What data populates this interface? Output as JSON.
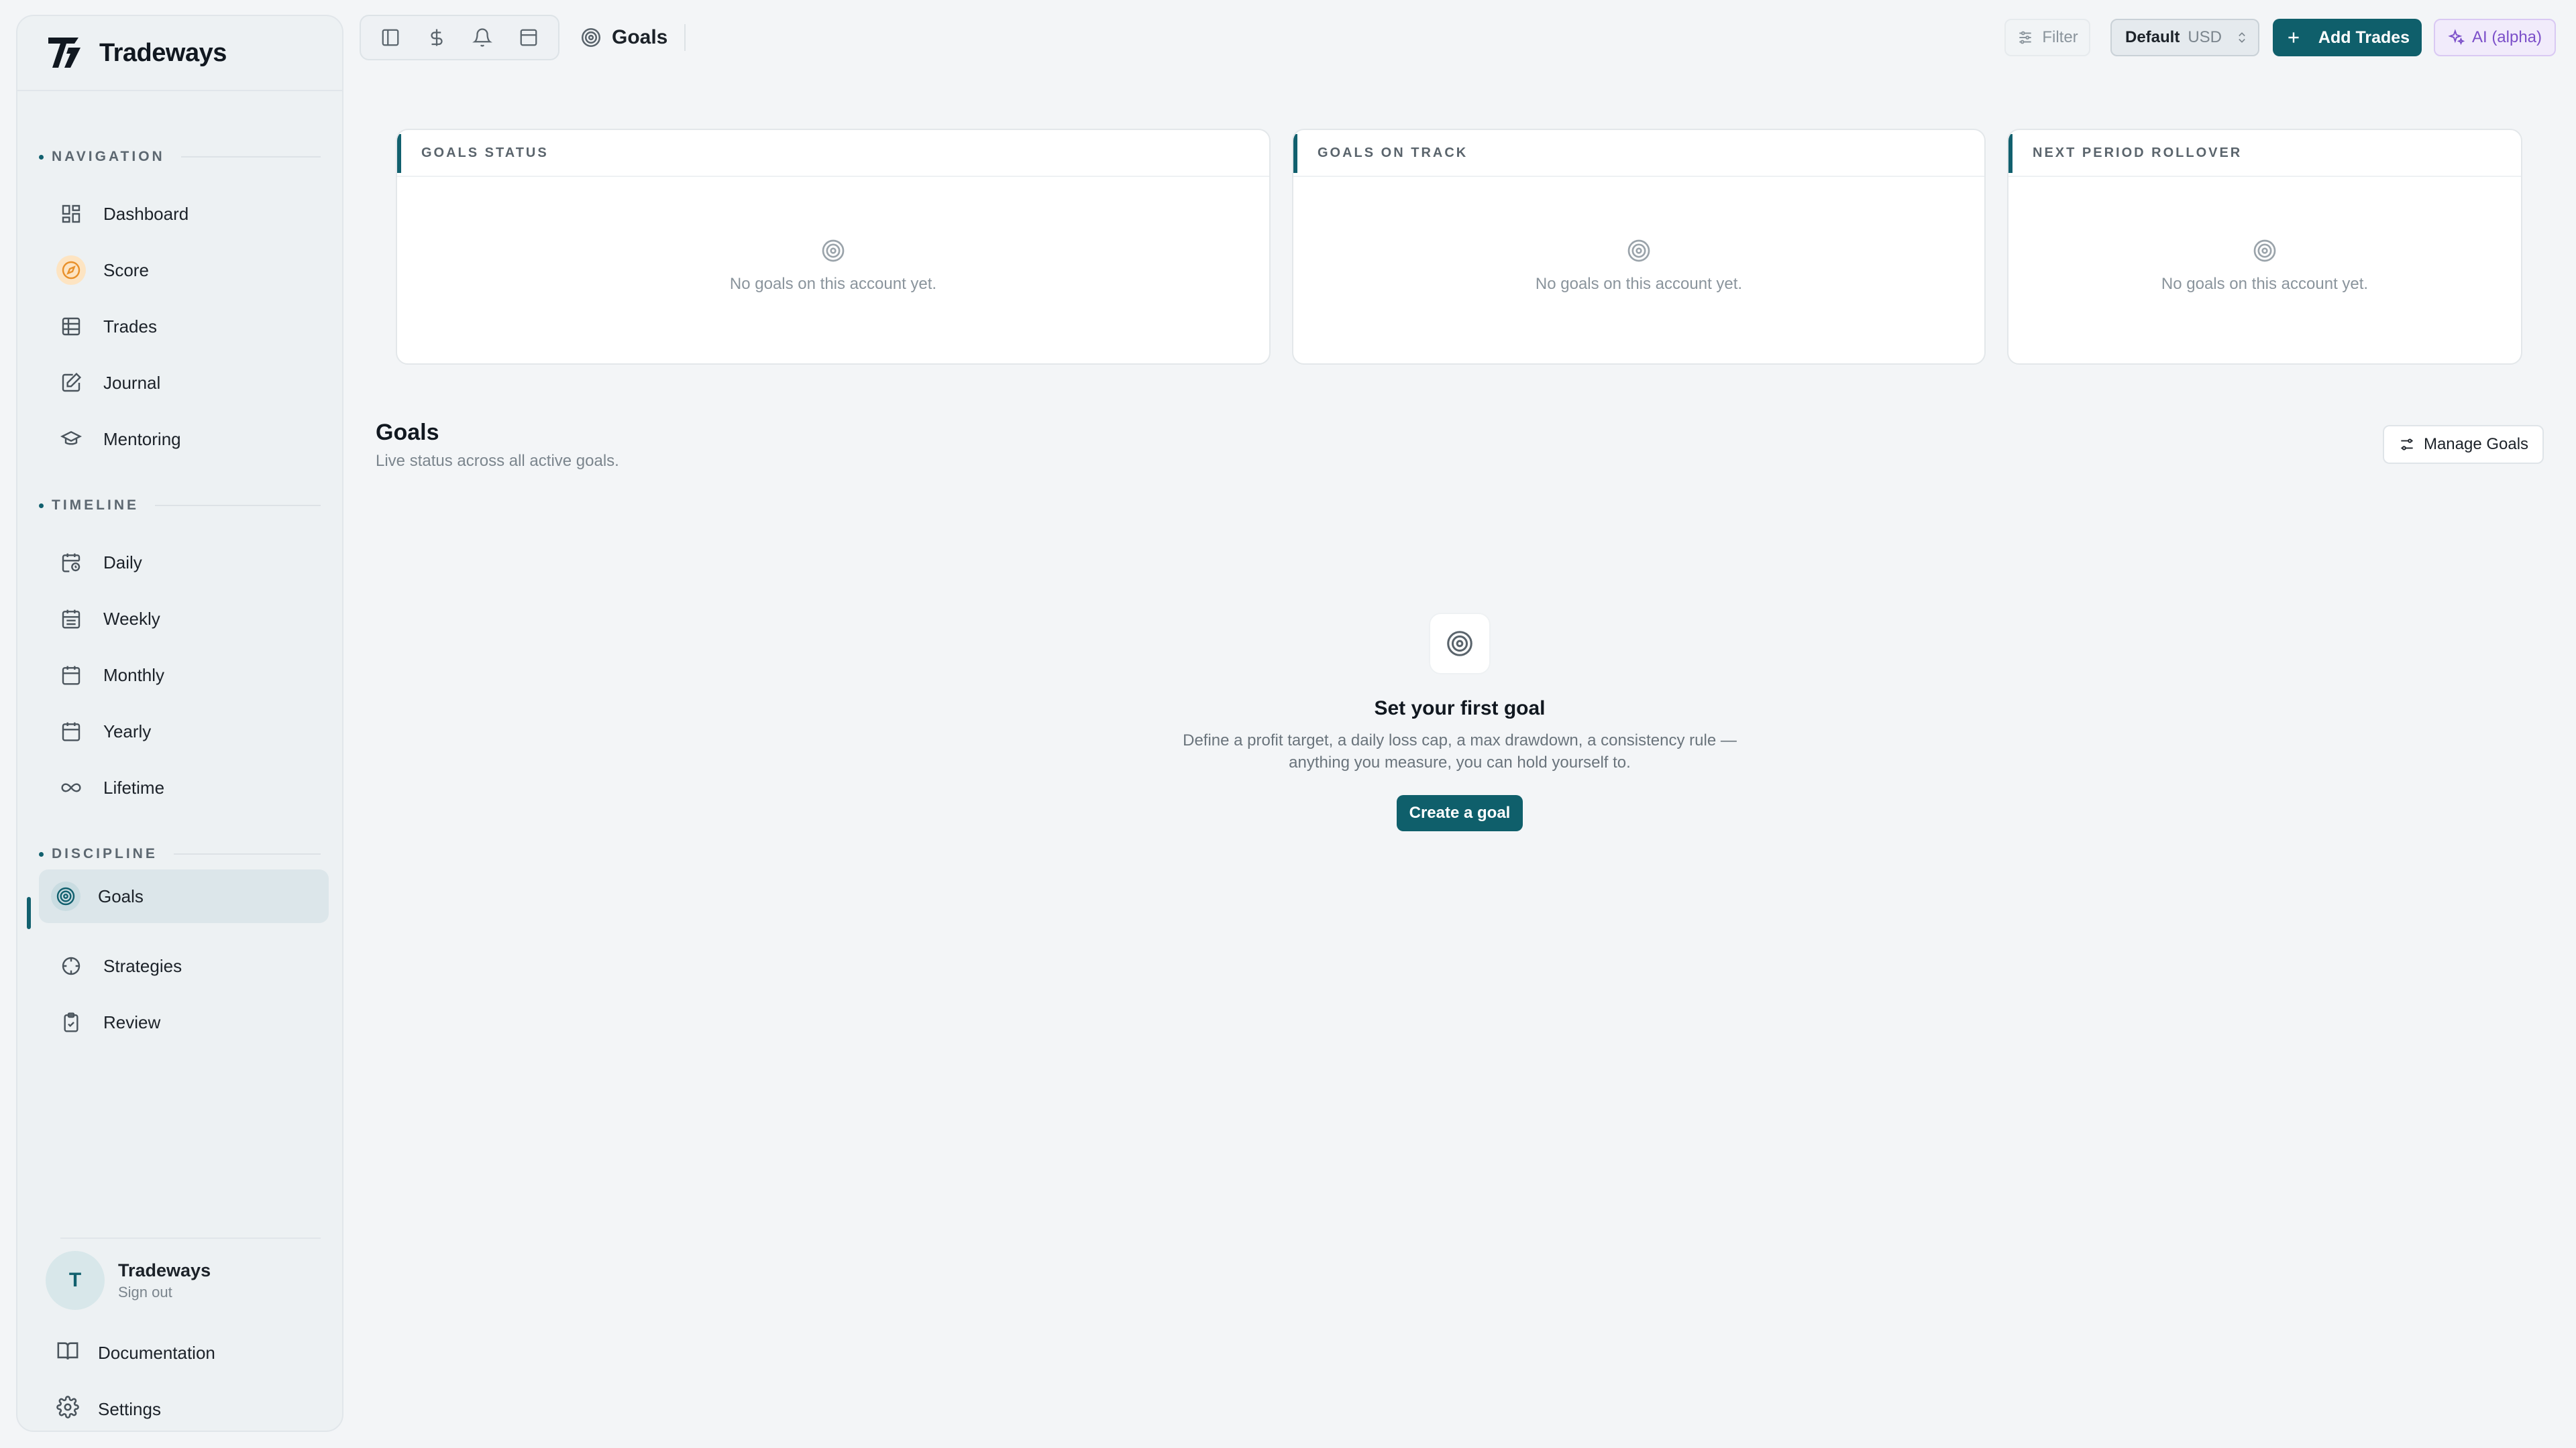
{
  "app": {
    "brand_name": "Tradeways"
  },
  "sidebar": {
    "sections": {
      "navigation": "NAVIGATION",
      "timeline": "TIMELINE",
      "discipline": "DISCIPLINE"
    },
    "items": [
      {
        "label": "Dashboard",
        "icon": "dashboard-icon"
      },
      {
        "label": "Score",
        "icon": "compass-icon"
      },
      {
        "label": "Trades",
        "icon": "table-icon"
      },
      {
        "label": "Journal",
        "icon": "journal-icon"
      },
      {
        "label": "Mentoring",
        "icon": "graduation-cap-icon"
      },
      {
        "label": "Daily",
        "icon": "calendar-clock-icon"
      },
      {
        "label": "Weekly",
        "icon": "calendar-week-icon"
      },
      {
        "label": "Monthly",
        "icon": "calendar-month-icon"
      },
      {
        "label": "Yearly",
        "icon": "calendar-icon"
      },
      {
        "label": "Lifetime",
        "icon": "infinity-icon"
      },
      {
        "label": "Goals",
        "icon": "target-icon",
        "active": true
      },
      {
        "label": "Strategies",
        "icon": "crosshair-icon"
      },
      {
        "label": "Review",
        "icon": "clipboard-check-icon"
      }
    ],
    "user": {
      "initial": "T",
      "name": "Tradeways",
      "action": "Sign out"
    },
    "footer": [
      {
        "label": "Documentation",
        "icon": "book-icon"
      },
      {
        "label": "Settings",
        "icon": "gear-icon"
      }
    ]
  },
  "topbar": {
    "breadcrumb": "Goals",
    "filter_label": "Filter",
    "account": {
      "name": "Default",
      "currency": "USD"
    },
    "add_trades_label": "Add Trades",
    "ai_label": "AI (alpha)"
  },
  "cards": [
    {
      "title": "GOALS STATUS",
      "empty_text": "No goals on this account yet."
    },
    {
      "title": "GOALS ON TRACK",
      "empty_text": "No goals on this account yet."
    },
    {
      "title": "NEXT PERIOD ROLLOVER",
      "empty_text": "No goals on this account yet."
    }
  ],
  "goals": {
    "title": "Goals",
    "subtitle": "Live status across all active goals.",
    "manage_label": "Manage Goals",
    "empty": {
      "title": "Set your first goal",
      "description_line1": "Define a profit target, a daily loss cap, a max drawdown, a consistency rule —",
      "description_line2": "anything you measure, you can hold yourself to.",
      "cta": "Create a goal"
    }
  },
  "colors": {
    "accent": "#0f5f6b",
    "background": "#f3f5f7",
    "ai_purple": "#7b4fc9",
    "score_orange": "#e8902a"
  }
}
